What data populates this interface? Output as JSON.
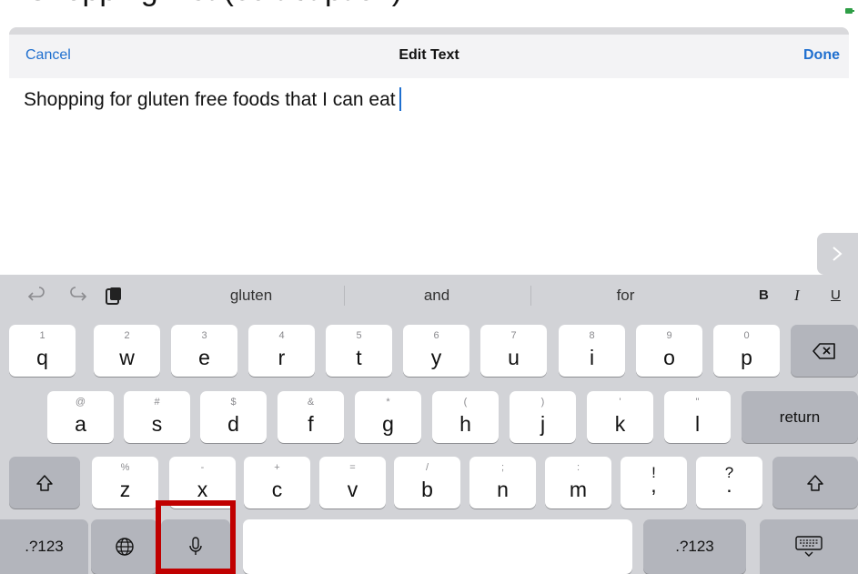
{
  "page": {
    "title_partial": "Shopping List (edit caption)"
  },
  "nav": {
    "cancel_label": "Cancel",
    "title": "Edit Text",
    "done_label": "Done"
  },
  "editor": {
    "text": "Shopping for gluten free foods that I can eat"
  },
  "suggestion_bar": {
    "suggestions": [
      "gluten",
      "and",
      "for"
    ],
    "format_bold": "B",
    "format_italic": "I",
    "format_underline": "U",
    "icons": [
      "undo-icon",
      "redo-icon",
      "paste-icon"
    ]
  },
  "keyboard": {
    "row1": [
      {
        "hint": "1",
        "key": "q"
      },
      {
        "hint": "2",
        "key": "w"
      },
      {
        "hint": "3",
        "key": "e"
      },
      {
        "hint": "4",
        "key": "r"
      },
      {
        "hint": "5",
        "key": "t"
      },
      {
        "hint": "6",
        "key": "y"
      },
      {
        "hint": "7",
        "key": "u"
      },
      {
        "hint": "8",
        "key": "i"
      },
      {
        "hint": "9",
        "key": "o"
      },
      {
        "hint": "0",
        "key": "p"
      }
    ],
    "row2": [
      {
        "hint": "@",
        "key": "a"
      },
      {
        "hint": "#",
        "key": "s"
      },
      {
        "hint": "$",
        "key": "d"
      },
      {
        "hint": "&",
        "key": "f"
      },
      {
        "hint": "*",
        "key": "g"
      },
      {
        "hint": "(",
        "key": "h"
      },
      {
        "hint": ")",
        "key": "j"
      },
      {
        "hint": "'",
        "key": "k"
      },
      {
        "hint": "\"",
        "key": "l"
      }
    ],
    "row3": [
      {
        "hint": "%",
        "key": "z"
      },
      {
        "hint": "-",
        "key": "x"
      },
      {
        "hint": "+",
        "key": "c"
      },
      {
        "hint": "=",
        "key": "v"
      },
      {
        "hint": "/",
        "key": "b"
      },
      {
        "hint": ";",
        "key": "n"
      },
      {
        "hint": ":",
        "key": "m"
      },
      {
        "hint": "!",
        "key": ","
      },
      {
        "hint": "?",
        "key": "."
      }
    ],
    "return_label": "return",
    "numbers_label_left": ".?123",
    "numbers_label_right": ".?123",
    "space_label": "",
    "icons": [
      "delete-icon",
      "shift-icon",
      "globe-icon",
      "microphone-icon",
      "hide-keyboard-icon"
    ]
  },
  "colors": {
    "accent": "#1f6fcf",
    "keyboard_bg": "#d2d3d7",
    "highlight": "#c00000"
  }
}
